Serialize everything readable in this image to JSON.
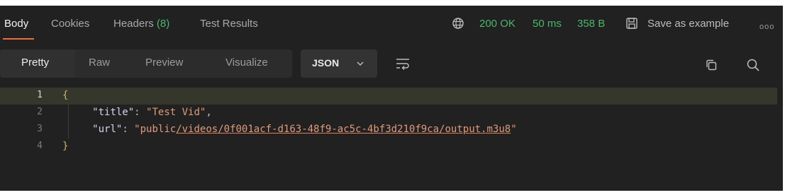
{
  "response_tabs": {
    "body": "Body",
    "cookies": "Cookies",
    "headers_label": "Headers",
    "headers_count": "(8)",
    "test_results": "Test Results"
  },
  "status": {
    "code": "200 OK",
    "time": "50 ms",
    "size": "358 B"
  },
  "actions": {
    "save_as_example": "Save as example",
    "more": "ooo"
  },
  "view_modes": {
    "pretty": "Pretty",
    "raw": "Raw",
    "preview": "Preview",
    "visualize": "Visualize",
    "selected": "Pretty"
  },
  "format": {
    "selected": "JSON"
  },
  "icons": {
    "globe": "globe-icon",
    "save": "save-icon",
    "wrap": "wrap-lines-icon",
    "copy": "copy-icon",
    "search": "search-icon",
    "chevron": "chevron-down-icon"
  },
  "colors": {
    "accent": "#f26b3a",
    "status_green": "#49b86a",
    "background": "#212121"
  },
  "code": {
    "line_numbers": [
      "1",
      "2",
      "3",
      "4"
    ],
    "open_brace": "{",
    "close_brace": "}",
    "title_key": "\"title\"",
    "title_value": "\"Test Vid\"",
    "url_key": "\"url\"",
    "url_prefix": "\"public",
    "url_path": "/videos/0f001acf-d163-48f9-ac5c-4bf3d210f9ca/output.m3u8",
    "url_suffix": "\""
  }
}
